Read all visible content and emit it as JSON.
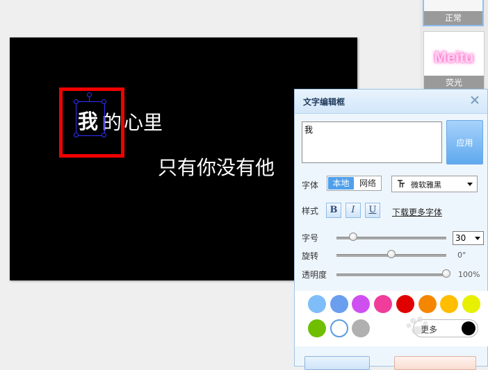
{
  "presets": [
    {
      "label": "正常"
    },
    {
      "label": "荧光",
      "preview_text": "Meitu",
      "glow_color": "#ff4fc3"
    }
  ],
  "canvas": {
    "background": "#000000",
    "lines": [
      "我",
      "的",
      "心里",
      "只有你没有他"
    ],
    "highlight_color": "#f10000",
    "selection_color": "#3030ff"
  },
  "dialog": {
    "title": "文字编辑框",
    "text_value": "我",
    "apply_label": "应用",
    "font_label": "字体",
    "font_source_tabs": [
      "本地",
      "网络"
    ],
    "font_selected": "微软雅黑",
    "style_label": "样式",
    "style_buttons": [
      "B",
      "I",
      "U"
    ],
    "download_more_fonts": "下载更多字体",
    "size_label": "字号",
    "size_value": "30",
    "rotate_label": "旋转",
    "rotate_value": "0°",
    "rotate_fraction": 0.5,
    "size_fraction": 0.15,
    "opacity_label": "透明度",
    "opacity_value": "100%",
    "opacity_fraction": 1.0,
    "colors_row1": [
      "#7fbdf8",
      "#6a9ff0",
      "#cf50f0",
      "#f03c9a",
      "#e00000",
      "#f58700",
      "#ffbe00",
      "#e6f000"
    ],
    "colors_row2": [
      "#6fbf00",
      "#ffffff",
      "#b0b0b0"
    ],
    "more_colors_label": "更多",
    "accent": "#4fa0ec"
  }
}
